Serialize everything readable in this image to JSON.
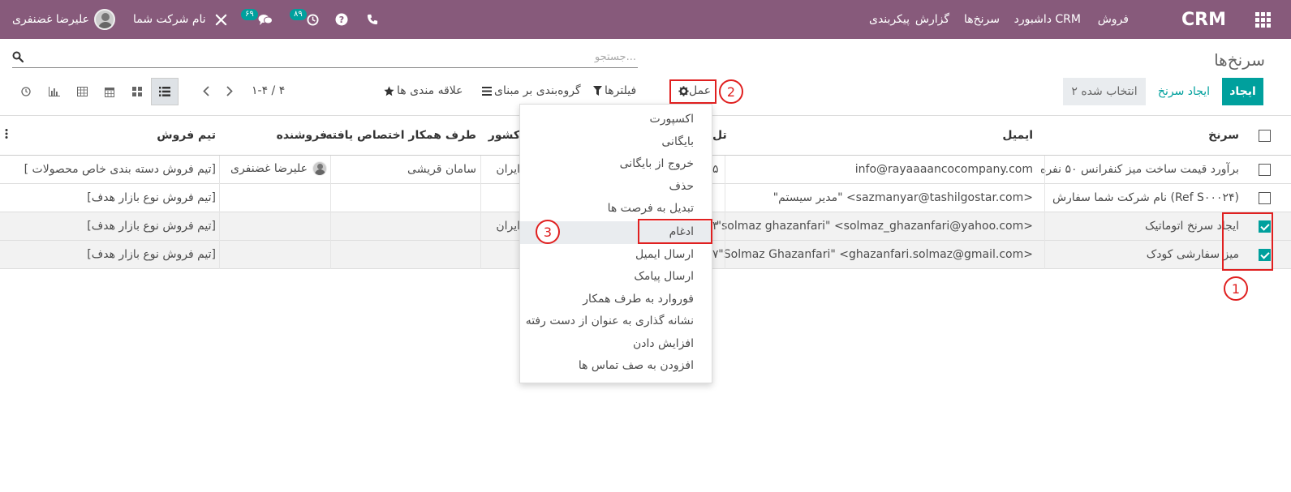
{
  "topbar": {
    "brand": "CRM",
    "menu": [
      "فروش",
      "داشبورد CRM",
      "سرنخ‌ها",
      "گزارش",
      "پیکربندی"
    ],
    "company": "نام شرکت شما",
    "user": "علیرضا غضنفری",
    "messages_count": "۶۹",
    "activities_count": "۸۹",
    "icons": [
      "apps-grid-icon",
      "phone-icon",
      "help-icon",
      "clock-icon",
      "chat-icon",
      "tools-icon"
    ]
  },
  "control": {
    "page_title": "سرنخ‌ها",
    "search_placeholder": "جستجو...",
    "create_label": "ایجاد",
    "create_lead_label": "ایجاد سرنخ",
    "selected_label": "۲ انتخاب شده",
    "action_label": "عمل",
    "filters_label": "فیلترها",
    "groupby_label": "گروه‌بندی بر مبنای",
    "favorites_label": "علاقه مندی ها",
    "pager": "۱-۴ / ۴"
  },
  "annotations": {
    "n1": "1",
    "n2": "2",
    "n3": "3"
  },
  "table": {
    "headers": {
      "lead": "سرنخ",
      "email": "ایمیل",
      "phone": "تل",
      "country": "کشور",
      "partner": "طرف همکار اختصاص یافته",
      "salesperson": "فروشنده",
      "team": "تیم فروش"
    },
    "rows": [
      {
        "lead": "برآورد قیمت ساخت میز کنفرانس ۵۰ نفره",
        "email": "info@rayaaaancocompany.com",
        "phone": "۵",
        "country": "ایران",
        "partner": "سامان قریشی",
        "salesperson": "علیرضا غضنفری",
        "team": "[ تیم فروش دسته بندی خاص محصولات]",
        "checked": false
      },
      {
        "lead": "نام شرکت شما سفارش (Ref S۰۰۰۲۴)",
        "email": "\"مدیر سیستم\" <sazmanyar@tashilgostar.com>",
        "phone": "",
        "country": "",
        "partner": "",
        "salesperson": "",
        "team": "[تیم فروش نوع بازار هدف]",
        "checked": false
      },
      {
        "lead": "ایجاد سرنخ اتوماتیک",
        "email": "\"solmaz ghazanfari\" <solmaz_ghazanfari@yahoo.com>",
        "phone": "۳",
        "country": "ایران",
        "partner": "",
        "salesperson": "",
        "team": "[تیم فروش نوع بازار هدف]",
        "checked": true
      },
      {
        "lead": "میز سفارشی کودک",
        "email": "\"Solmaz Ghazanfari\" <ghazanfari.solmaz@gmail.com>",
        "phone": "۷",
        "country": "",
        "partner": "",
        "salesperson": "",
        "team": "[تیم فروش نوع بازار هدف]",
        "checked": true
      }
    ]
  },
  "action_menu": {
    "items": [
      "اکسپورت",
      "بایگانی",
      "خروج از بایگانی",
      "حذف",
      "تبدیل به فرصت ها",
      "ادغام",
      "ارسال ایمیل",
      "ارسال پیامک",
      "فوروارد به طرف همکار",
      "نشانه گذاری به عنوان از دست رفته",
      "افزایش دادن",
      "افزودن به صف تماس ها"
    ],
    "highlighted": "ادغام"
  },
  "colors": {
    "topbar": "#875a7b",
    "accent": "#00a09d",
    "annotation": "#e02020"
  }
}
